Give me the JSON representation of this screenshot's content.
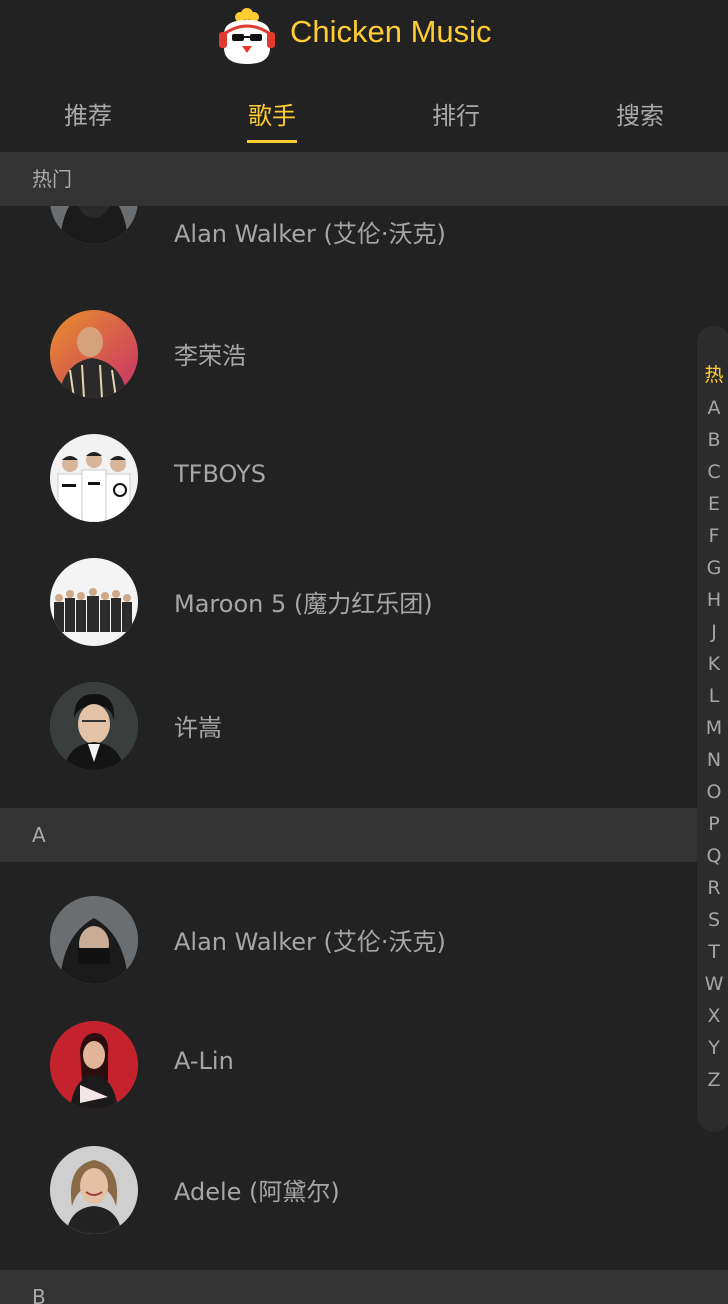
{
  "app": {
    "title": "Chicken Music"
  },
  "colors": {
    "accent": "#ffcd32",
    "background": "#222222",
    "group_header": "#333333"
  },
  "tabs": [
    {
      "label": "推荐",
      "active": false
    },
    {
      "label": "歌手",
      "active": true
    },
    {
      "label": "排行",
      "active": false
    },
    {
      "label": "搜索",
      "active": false
    }
  ],
  "groups": [
    {
      "title": "热门",
      "singers": [
        {
          "name": "Alan Walker (艾伦·沃克)"
        },
        {
          "name": "李荣浩"
        },
        {
          "name": "TFBOYS"
        },
        {
          "name": "Maroon 5 (魔力红乐团)"
        },
        {
          "name": "许嵩"
        }
      ]
    },
    {
      "title": "A",
      "singers": [
        {
          "name": "Alan Walker (艾伦·沃克)"
        },
        {
          "name": "A-Lin"
        },
        {
          "name": "Adele (阿黛尔)"
        }
      ]
    },
    {
      "title": "B",
      "singers": []
    }
  ],
  "shortcut": {
    "active_index": 0,
    "items": [
      "热",
      "A",
      "B",
      "C",
      "E",
      "F",
      "G",
      "H",
      "J",
      "K",
      "L",
      "M",
      "N",
      "O",
      "P",
      "Q",
      "R",
      "S",
      "T",
      "W",
      "X",
      "Y",
      "Z"
    ]
  }
}
